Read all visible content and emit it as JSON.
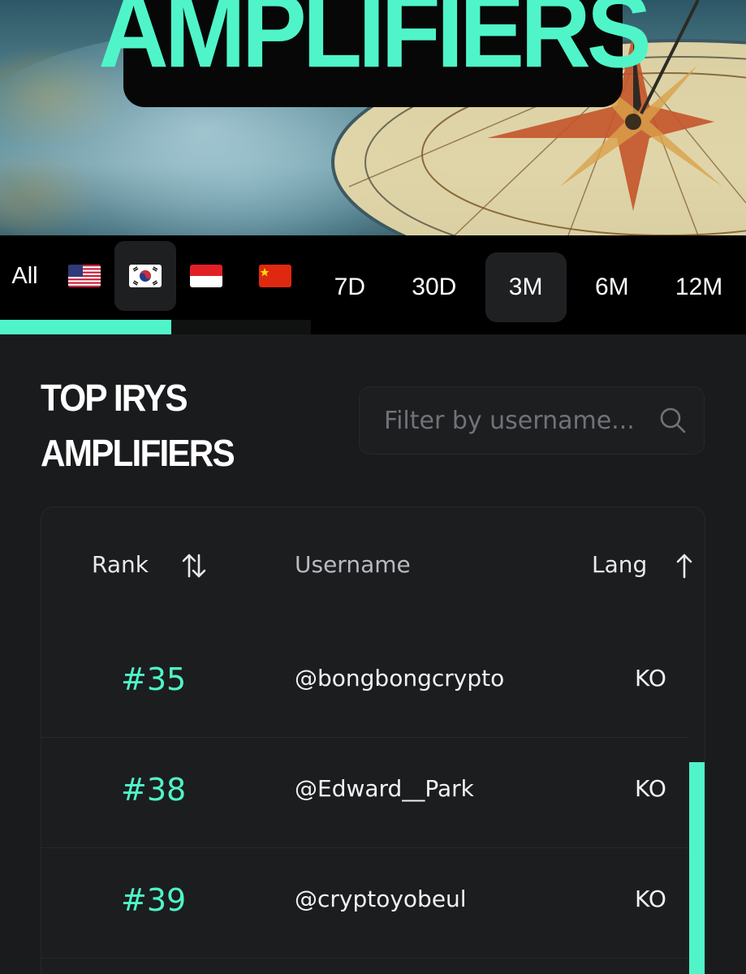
{
  "hero": {
    "title": "AMPLIFIERS"
  },
  "region_filter": {
    "all_label": "All",
    "flags": [
      {
        "name": "flag-us-icon",
        "country": "US"
      },
      {
        "name": "flag-kr-icon",
        "country": "KR",
        "active": true
      },
      {
        "name": "flag-id-icon",
        "country": "ID"
      },
      {
        "name": "flag-cn-icon",
        "country": "CN"
      }
    ]
  },
  "time_filter": {
    "tabs": [
      "7D",
      "30D",
      "3M",
      "6M",
      "12M"
    ],
    "active": "3M"
  },
  "leaderboard": {
    "title_line1": "TOP IRYS",
    "title_line2": "AMPLIFIERS",
    "search": {
      "placeholder": "Filter by username...",
      "value": ""
    },
    "columns": {
      "rank": "Rank",
      "username": "Username",
      "lang": "Lang"
    },
    "rows": [
      {
        "rank": "#35",
        "username": "@bongbongcrypto",
        "lang": "KO"
      },
      {
        "rank": "#38",
        "username": "@Edward__Park",
        "lang": "KO"
      },
      {
        "rank": "#39",
        "username": "@cryptoyobeul",
        "lang": "KO"
      }
    ]
  },
  "colors": {
    "accent": "#4ff5c8",
    "background": "#1a1b1d",
    "bar": "#000000"
  }
}
